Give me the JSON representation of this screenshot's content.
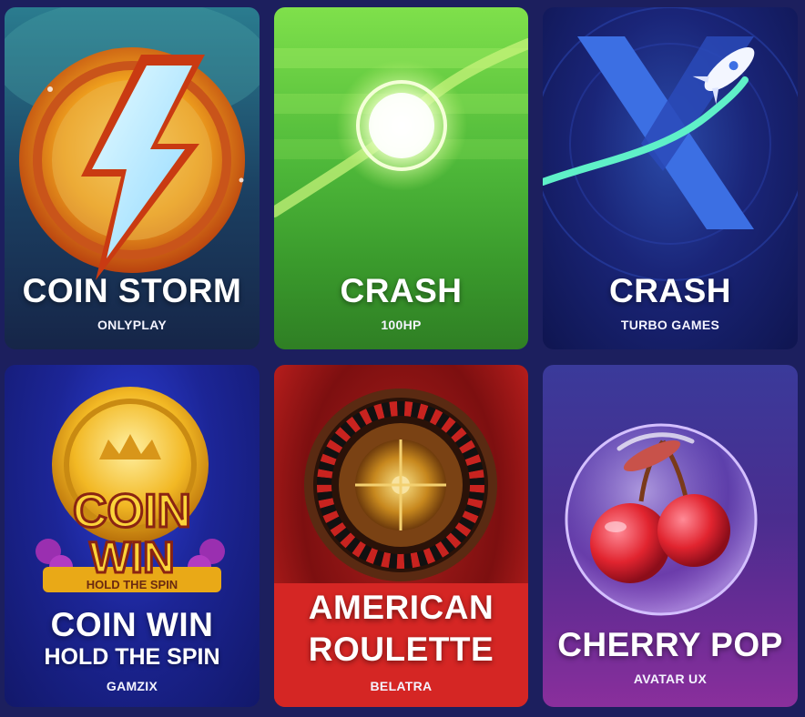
{
  "games": [
    {
      "title": "COIN STORM",
      "subtitle": "",
      "provider": "ONLYPLAY",
      "icon": "lightning-coin-icon"
    },
    {
      "title": "CRASH",
      "subtitle": "",
      "provider": "100HP",
      "icon": "glowing-orb-icon"
    },
    {
      "title": "CRASH",
      "subtitle": "",
      "provider": "TURBO GAMES",
      "icon": "rocket-x-icon"
    },
    {
      "title": "COIN WIN",
      "subtitle": "HOLD THE SPIN",
      "provider": "GAMZIX",
      "icon": "gold-coin-icon",
      "logo_text_1": "COIN",
      "logo_text_2": "WIN",
      "logo_text_3": "HOLD THE SPIN"
    },
    {
      "title": "AMERICAN",
      "subtitle": "ROULETTE",
      "provider": "BELATRA",
      "icon": "roulette-wheel-icon"
    },
    {
      "title": "CHERRY POP",
      "subtitle": "",
      "provider": "AVATAR UX",
      "icon": "cherry-bubble-icon"
    }
  ]
}
